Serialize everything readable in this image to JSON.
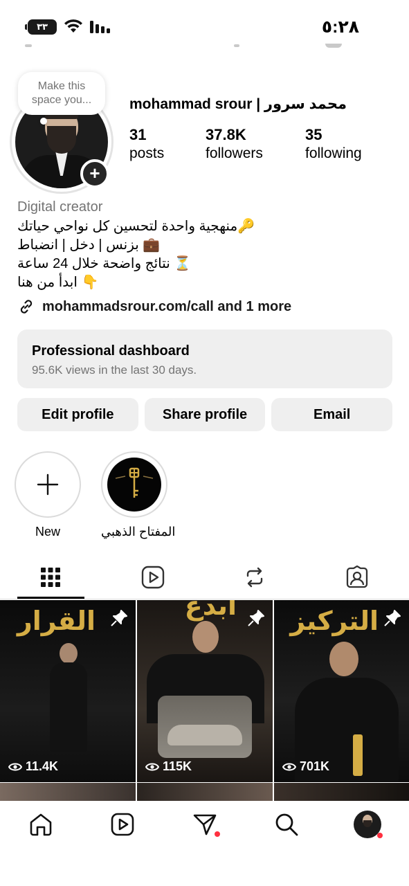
{
  "status_bar": {
    "time": "٥:٢٨",
    "battery_level": "٣٣"
  },
  "profile": {
    "note_placeholder": "Make this space you...",
    "username": "mohammad srour | محمد سرور",
    "stats": [
      {
        "value": "31",
        "label": "posts"
      },
      {
        "value": "37.8K",
        "label": "followers"
      },
      {
        "value": "35",
        "label": "following"
      }
    ],
    "category": "Digital creator",
    "bio_lines": [
      "🔑منهجية واحدة لتحسين كل نواحي حياتك",
      "💼 بزنس | دخل | انضباط",
      "⏳ نتائج واضحة خلال 24 ساعة",
      "👇 ابدأ من هنا"
    ],
    "link": "mohammadsrour.com/call and 1 more"
  },
  "dashboard": {
    "title": "Professional dashboard",
    "subtitle": "95.6K views in the last 30 days."
  },
  "actions": {
    "edit": "Edit profile",
    "share": "Share profile",
    "email": "Email"
  },
  "highlights": [
    {
      "label": "New",
      "icon": "plus-icon"
    },
    {
      "label": "المفتاح الذهبي",
      "icon": "golden-key-cover"
    }
  ],
  "tabs": [
    {
      "icon": "grid-icon",
      "active": true
    },
    {
      "icon": "reels-icon",
      "active": false
    },
    {
      "icon": "reposts-icon",
      "active": false
    },
    {
      "icon": "tagged-icon",
      "active": false
    }
  ],
  "posts": [
    {
      "title": "القرار",
      "views": "11.4K",
      "pinned": true
    },
    {
      "title": "ابدع",
      "views": "115K",
      "pinned": true
    },
    {
      "title": "التركيز",
      "views": "701K",
      "pinned": true
    }
  ],
  "bottom_nav": [
    {
      "icon": "home-icon"
    },
    {
      "icon": "reels-icon"
    },
    {
      "icon": "messages-icon",
      "badge": true
    },
    {
      "icon": "search-icon"
    },
    {
      "icon": "profile-avatar",
      "badge": true
    }
  ],
  "colors": {
    "button_bg": "#efefef",
    "muted_text": "#737373",
    "accent_gold": "#d5ad45",
    "notification_red": "#ff3040"
  }
}
